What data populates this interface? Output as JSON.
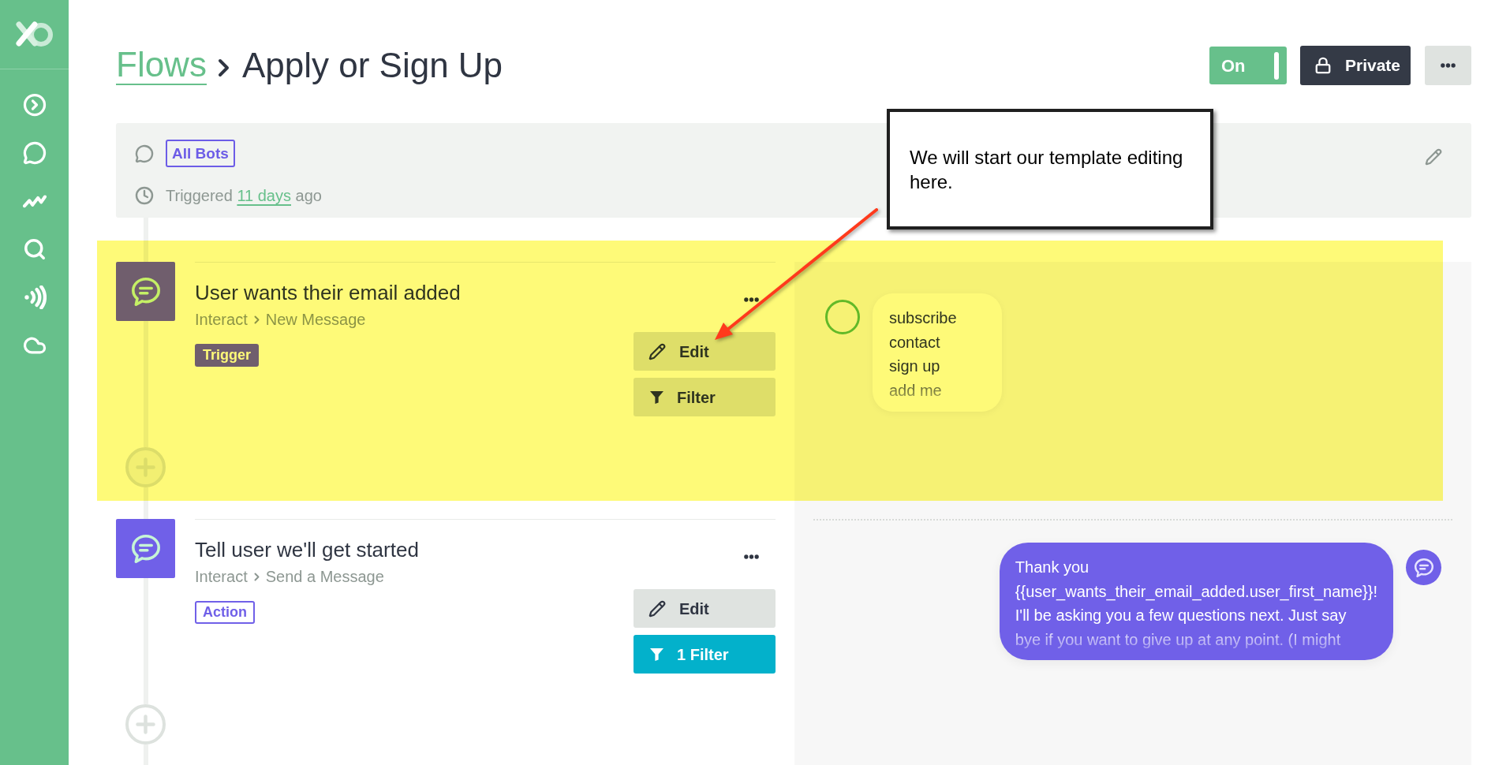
{
  "breadcrumb": {
    "parent": "Flows",
    "current": "Apply or Sign Up"
  },
  "header": {
    "toggle": {
      "label": "On",
      "on": true
    },
    "privacy_button": {
      "label": "Private"
    }
  },
  "flow_info": {
    "bot_tag": "All Bots",
    "triggered": {
      "prefix": "Triggered",
      "link": "11 days",
      "suffix": "ago"
    }
  },
  "annotation": {
    "callout": "We will start our template editing here."
  },
  "steps": [
    {
      "title": "User wants their email added",
      "path": [
        "Interact",
        "New Message"
      ],
      "badge": {
        "label": "Trigger",
        "kind": "trigger"
      },
      "buttons": [
        {
          "kind": "edit",
          "label": "Edit"
        },
        {
          "kind": "filter",
          "label": "Filter",
          "active": false
        }
      ],
      "highlighted": true,
      "preview": {
        "kind": "keywords",
        "keywords": [
          "subscribe",
          "contact",
          "sign up",
          "add me"
        ]
      }
    },
    {
      "title": "Tell user we'll get started",
      "path": [
        "Interact",
        "Send a Message"
      ],
      "badge": {
        "label": "Action",
        "kind": "action"
      },
      "buttons": [
        {
          "kind": "edit",
          "label": "Edit"
        },
        {
          "kind": "filter",
          "label": "1 Filter",
          "active": true
        }
      ],
      "highlighted": false,
      "preview": {
        "kind": "bot_message",
        "lines": [
          "Thank you",
          "{{user_wants_their_email_added.user_first_name}}!",
          "I'll be asking you a few questions next. Just say",
          "bye if you want to give up at any point. (I might"
        ]
      }
    }
  ]
}
